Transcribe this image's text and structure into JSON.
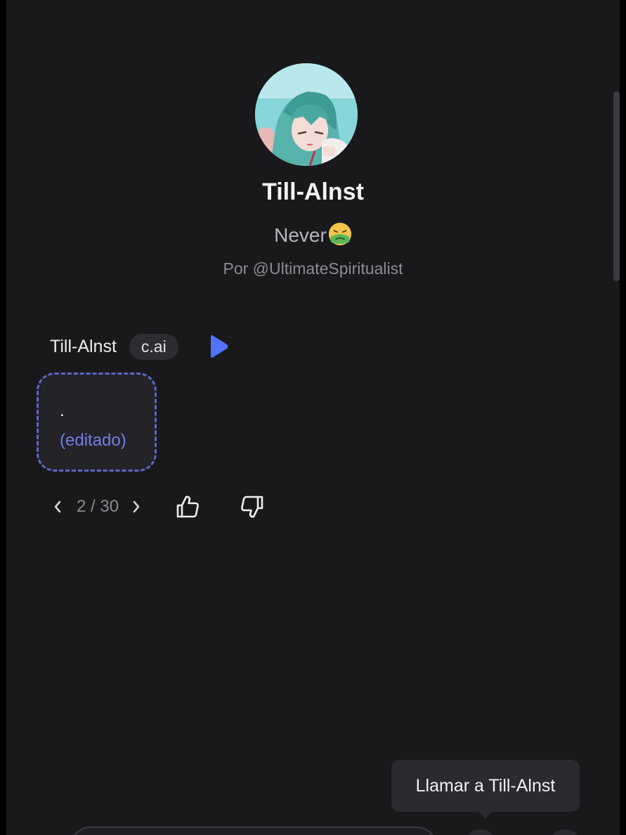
{
  "character": {
    "name": "Till-Alnst",
    "tagline": "Never",
    "tagline_emoji": "nauseated-face",
    "author": "Por @UltimateSpiritualist"
  },
  "message": {
    "sender": "Till-Alnst",
    "badge": "c.ai",
    "text": ".",
    "edited_label": "(editado)",
    "counter": "2 / 30"
  },
  "tooltip": {
    "text": "Llamar a Till-Alnst"
  },
  "colors": {
    "background": "#19191c",
    "accent": "#5a67c7",
    "play_button": "#4f73ff",
    "edited_text": "#6f7fe6"
  },
  "icons": [
    "play-icon",
    "chevron-left-icon",
    "chevron-right-icon",
    "thumbs-up-icon",
    "thumbs-down-icon",
    "nauseated-face-emoji"
  ]
}
